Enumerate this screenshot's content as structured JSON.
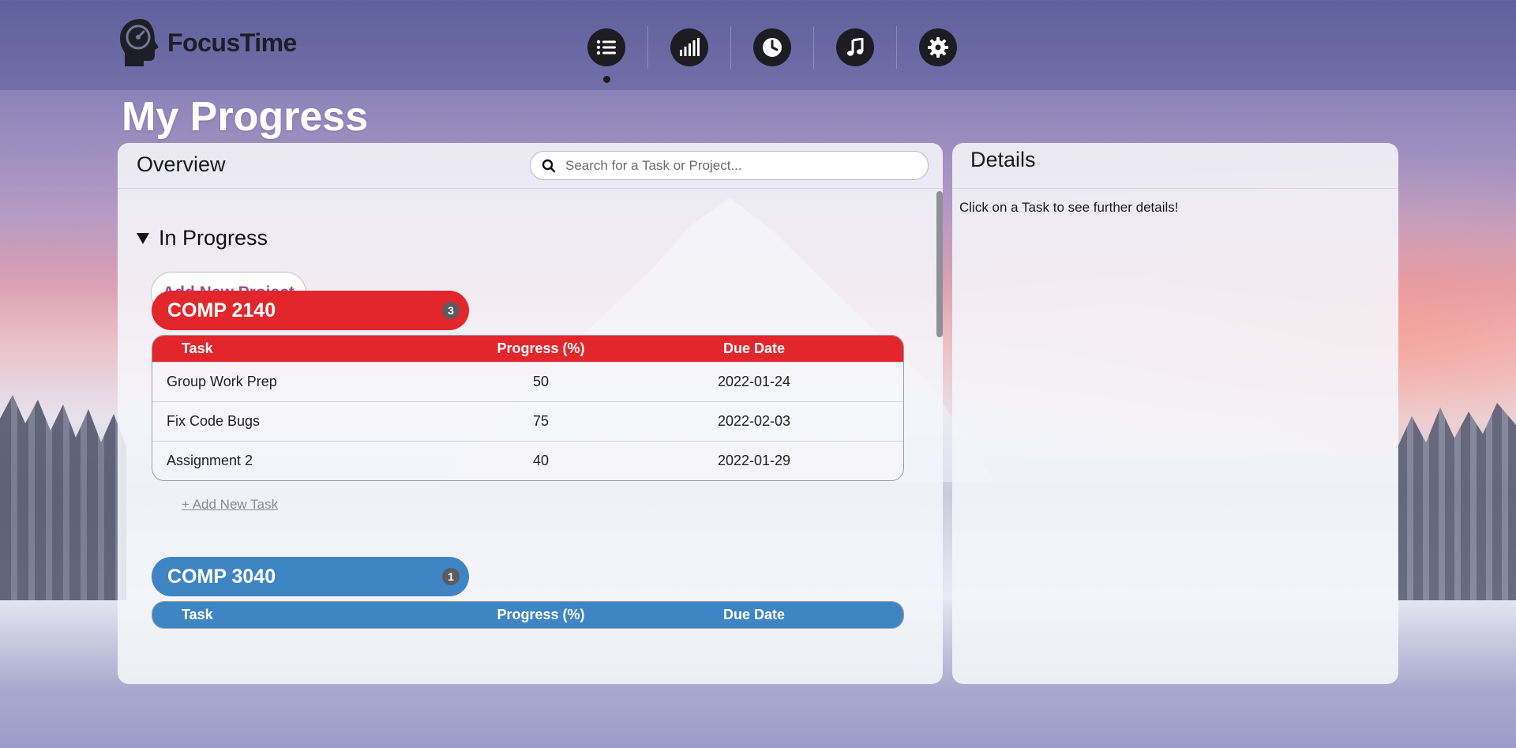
{
  "app": {
    "name": "FocusTime"
  },
  "nav": {
    "items": [
      {
        "name": "tasks",
        "icon": "list-icon",
        "active": true
      },
      {
        "name": "stats",
        "icon": "bar-chart-icon",
        "active": false
      },
      {
        "name": "timer",
        "icon": "clock-icon",
        "active": false
      },
      {
        "name": "music",
        "icon": "music-note-icon",
        "active": false
      },
      {
        "name": "settings",
        "icon": "gear-icon",
        "active": false
      }
    ]
  },
  "page": {
    "title": "My Progress"
  },
  "overview": {
    "title": "Overview",
    "search": {
      "placeholder": "Search for a Task or Project...",
      "value": ""
    },
    "section_title": "In Progress",
    "add_project_label": "Add New Project",
    "projects": [
      {
        "name": "COMP 2140",
        "count": "3",
        "color": "#e3262b",
        "columns": [
          "Task",
          "Progress (%)",
          "Due Date"
        ],
        "tasks": [
          {
            "task": "Group Work Prep",
            "progress": "50",
            "due": "2022-01-24"
          },
          {
            "task": "Fix Code Bugs",
            "progress": "75",
            "due": "2022-02-03"
          },
          {
            "task": "Assignment 2",
            "progress": "40",
            "due": "2022-01-29"
          }
        ],
        "add_task_label": "+ Add New Task"
      },
      {
        "name": "COMP 3040",
        "count": "1",
        "color": "#3f85c4",
        "columns": [
          "Task",
          "Progress (%)",
          "Due Date"
        ]
      }
    ]
  },
  "details": {
    "title": "Details",
    "hint": "Click on a Task to see further details!"
  }
}
